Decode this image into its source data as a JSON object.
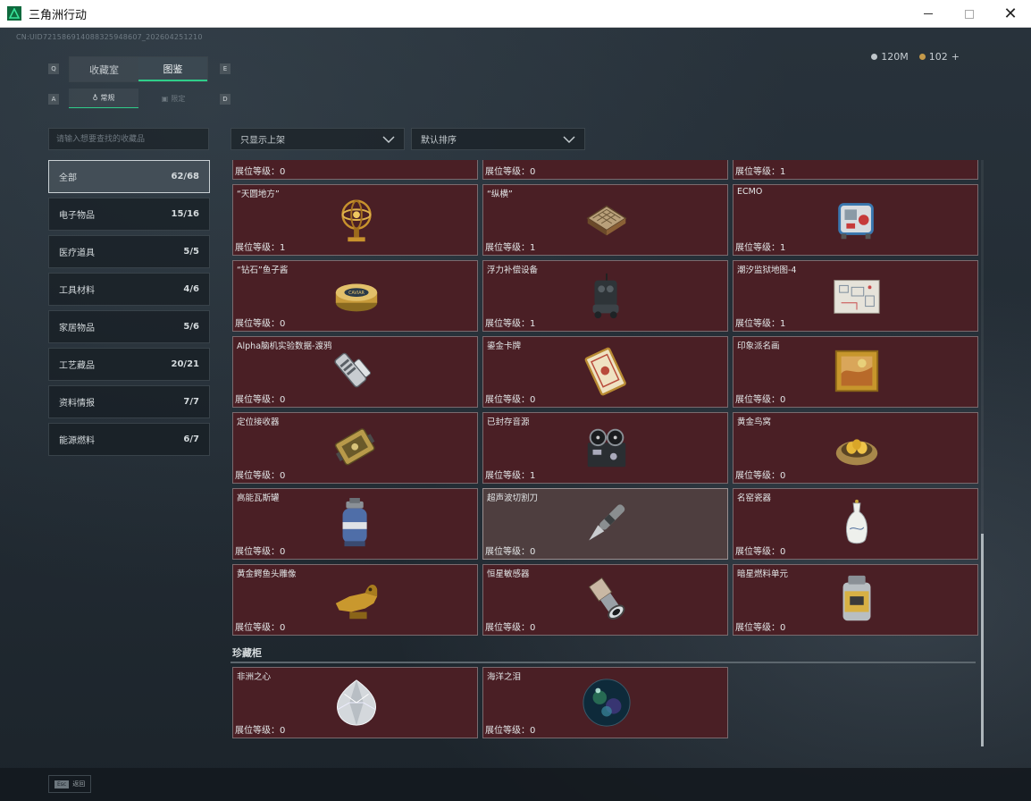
{
  "window": {
    "title": "三角洲行动",
    "min_label": "—",
    "max_label": "",
    "close_label": "✕"
  },
  "uid": "CN:UID721586914088325948607_202604251210",
  "currency": {
    "silver": "120M",
    "gold": "102",
    "plus": "+"
  },
  "keys": {
    "tab_left": "Q",
    "tab_right": "E",
    "sub_left": "A",
    "sub_right": "D"
  },
  "tabs": [
    {
      "label": "收藏室"
    },
    {
      "label": "图鉴"
    }
  ],
  "subtabs": [
    {
      "label": "常规"
    },
    {
      "label": "限定"
    }
  ],
  "search": {
    "placeholder": "请输入想要查找的收藏品"
  },
  "categories": [
    {
      "label": "全部",
      "count": "62/68"
    },
    {
      "label": "电子物品",
      "count": "15/16"
    },
    {
      "label": "医疗道具",
      "count": "5/5"
    },
    {
      "label": "工具材料",
      "count": "4/6"
    },
    {
      "label": "家居物品",
      "count": "5/6"
    },
    {
      "label": "工艺藏品",
      "count": "20/21"
    },
    {
      "label": "资料情报",
      "count": "7/7"
    },
    {
      "label": "能源燃料",
      "count": "6/7"
    }
  ],
  "filters": {
    "display": "只显示上架",
    "sort": "默认排序"
  },
  "level_label": "展位等级：",
  "top_partial_levels": [
    "0",
    "0",
    "1"
  ],
  "items": [
    {
      "name": "“天圆地方”",
      "level": "1",
      "icon": "armillary-sphere-icon"
    },
    {
      "name": "“纵横”",
      "level": "1",
      "icon": "chess-board-icon"
    },
    {
      "name": "ECMO",
      "level": "1",
      "icon": "ecmo-machine-icon"
    },
    {
      "name": "“钻石”鱼子酱",
      "level": "0",
      "icon": "caviar-tin-icon"
    },
    {
      "name": "浮力补偿设备",
      "level": "1",
      "icon": "buoyancy-device-icon"
    },
    {
      "name": "潮汐监狱地图-4",
      "level": "1",
      "icon": "prison-map-icon"
    },
    {
      "name": "Alpha脑机实验数据-渡鸦",
      "level": "0",
      "icon": "data-drive-icon"
    },
    {
      "name": "鎏金卡牌",
      "level": "0",
      "icon": "gilded-card-icon"
    },
    {
      "name": "印象派名画",
      "level": "0",
      "icon": "framed-painting-icon"
    },
    {
      "name": "定位接收器",
      "level": "0",
      "icon": "locator-receiver-icon"
    },
    {
      "name": "已封存音源",
      "level": "1",
      "icon": "tape-recorder-icon"
    },
    {
      "name": "黄金鸟窝",
      "level": "0",
      "icon": "golden-nest-icon"
    },
    {
      "name": "高能瓦斯罐",
      "level": "0",
      "icon": "gas-canister-icon"
    },
    {
      "name": "超声波切割刀",
      "level": "0",
      "icon": "ultrasonic-cutter-icon"
    },
    {
      "name": "名窑瓷器",
      "level": "0",
      "icon": "porcelain-vase-icon"
    },
    {
      "name": "黄金鳄鱼头雕像",
      "level": "0",
      "icon": "gold-crocodile-statue-icon"
    },
    {
      "name": "恒星敏感器",
      "level": "0",
      "icon": "star-sensor-icon"
    },
    {
      "name": "暗星燃料单元",
      "level": "0",
      "icon": "fuel-cell-icon"
    }
  ],
  "vault": {
    "title": "珍藏柜",
    "items": [
      {
        "name": "非洲之心",
        "level": "0",
        "icon": "diamond-icon"
      },
      {
        "name": "海洋之泪",
        "level": "0",
        "icon": "ocean-orb-icon"
      }
    ]
  },
  "footer": {
    "esc_key": "Esc",
    "back_label": "返回"
  },
  "colors": {
    "accent": "#2fce8a",
    "card_bg": "#4a1f25",
    "card_border": "#7a6a6e"
  }
}
